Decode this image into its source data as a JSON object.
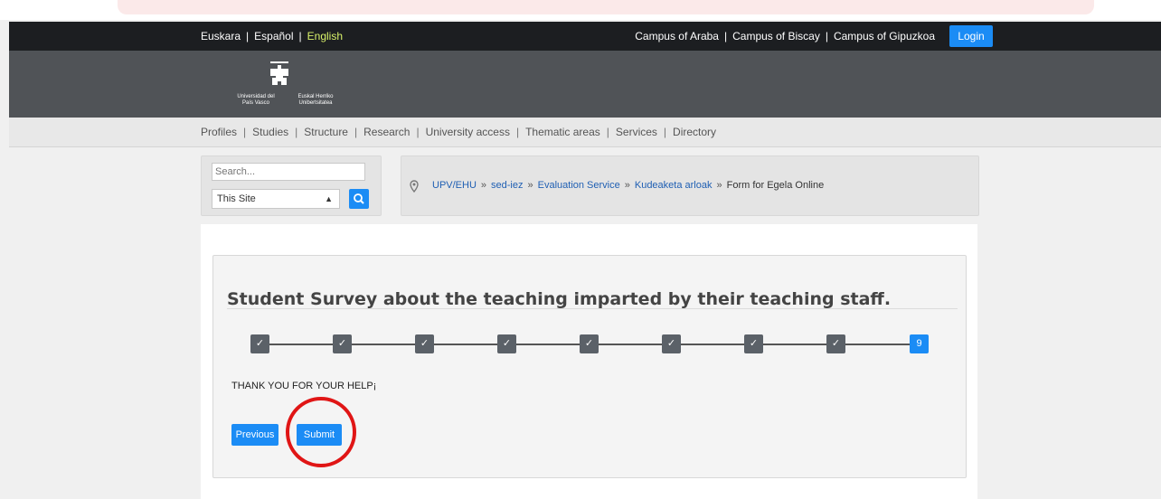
{
  "top_bar": {
    "languages": [
      "Euskara",
      "Español",
      "English"
    ],
    "active_language": "English",
    "campuses": [
      "Campus of Araba",
      "Campus of Biscay",
      "Campus of Gipuzkoa"
    ],
    "login_label": "Login"
  },
  "header": {
    "logo_text_left": "Universidad del País Vasco",
    "logo_text_right": "Euskal Herriko Unibertsitatea"
  },
  "nav": {
    "items": [
      "Profiles",
      "Studies",
      "Structure",
      "Research",
      "University access",
      "Thematic areas",
      "Services",
      "Directory"
    ]
  },
  "search": {
    "placeholder": "Search...",
    "scope_selected": "This Site"
  },
  "breadcrumb": {
    "items": [
      "UPV/EHU",
      "sed-iez",
      "Evaluation Service",
      "Kudeaketa arloak"
    ],
    "current": "Form for Egela Online"
  },
  "survey": {
    "title": "Student Survey about the teaching imparted by their teaching staff.",
    "steps": [
      {
        "label": "✓",
        "state": "done"
      },
      {
        "label": "✓",
        "state": "done"
      },
      {
        "label": "✓",
        "state": "done"
      },
      {
        "label": "✓",
        "state": "done"
      },
      {
        "label": "✓",
        "state": "done"
      },
      {
        "label": "✓",
        "state": "done"
      },
      {
        "label": "✓",
        "state": "done"
      },
      {
        "label": "✓",
        "state": "done"
      },
      {
        "label": "9",
        "state": "current"
      }
    ],
    "message": "THANK YOU FOR YOUR HELP¡",
    "previous_label": "Previous",
    "submit_label": "Submit"
  },
  "colors": {
    "accent": "#1b8cf5",
    "annotation": "#e01515",
    "active_language": "#d9f26a"
  }
}
